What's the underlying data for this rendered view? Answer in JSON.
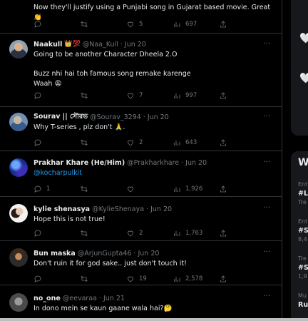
{
  "tweets": [
    {
      "name": "",
      "badges": "",
      "handle": "",
      "date": "",
      "text": "Now they'll justify using a Punjabi song in Gujarat based movie. Great 👏",
      "replies": "",
      "retweets": "",
      "likes": "5",
      "views": "697"
    },
    {
      "name": "Naakull",
      "badges": "👑💯",
      "handle": "@Naa_Kull",
      "date": "Jun 20",
      "text": "Going to be another Character Dheela 2.O\n\nBuzz nhi hai toh famous song remake karenge\nWaah 😩",
      "replies": "",
      "retweets": "",
      "likes": "7",
      "views": "997"
    },
    {
      "name": "Sourav || সৌরভ",
      "badges": "",
      "handle": "@Sourav_3294",
      "date": "Jun 20",
      "text": "Why T-series , plz don't 🙏.",
      "replies": "",
      "retweets": "",
      "likes": "2",
      "views": "643"
    },
    {
      "name": "Prakhar Khare (He/Him)",
      "badges": "",
      "handle": "@Prakharkhare",
      "date": "Jun 20",
      "text": "@kocharpulkit",
      "replies": "1",
      "retweets": "",
      "likes": "",
      "views": "1,926"
    },
    {
      "name": "kylie shenasya",
      "badges": "",
      "handle": "@KylieShenaya",
      "date": "Jun 20",
      "text": "Hope this is not true!",
      "replies": "",
      "retweets": "",
      "likes": "2",
      "views": "1,763"
    },
    {
      "name": "Bun maska",
      "badges": "",
      "handle": "@ArjunGupta46",
      "date": "Jun 20",
      "text": "Don't ruin it for god sake.. just don't touch it!",
      "replies": "",
      "retweets": "",
      "likes": "19",
      "views": "2,578"
    },
    {
      "name": "no_one",
      "badges": "",
      "handle": "@eevaraa",
      "date": "Jun 21",
      "text": "In dono mein se kaun gaane wala hai?🤔",
      "replies": "",
      "retweets": "",
      "likes": "",
      "views": ""
    }
  ],
  "more_label": "···",
  "sidebar": {
    "hearts": [
      "🤍",
      "🤍"
    ],
    "trends_title": "W",
    "trends": [
      {
        "category": "Ent",
        "topic": "#L",
        "count": "Tre"
      },
      {
        "category": "Ent",
        "topic": "#S",
        "count": "8,4"
      },
      {
        "category": "Tre",
        "topic": "#S",
        "count": "1,9"
      },
      {
        "category": "Mu",
        "topic": "Ru",
        "count": ""
      }
    ]
  },
  "colors": {
    "background": "#000000",
    "text": "#e7e9ea",
    "muted": "#71767b",
    "accent": "#1d9bf0",
    "divider": "#2f3336"
  }
}
